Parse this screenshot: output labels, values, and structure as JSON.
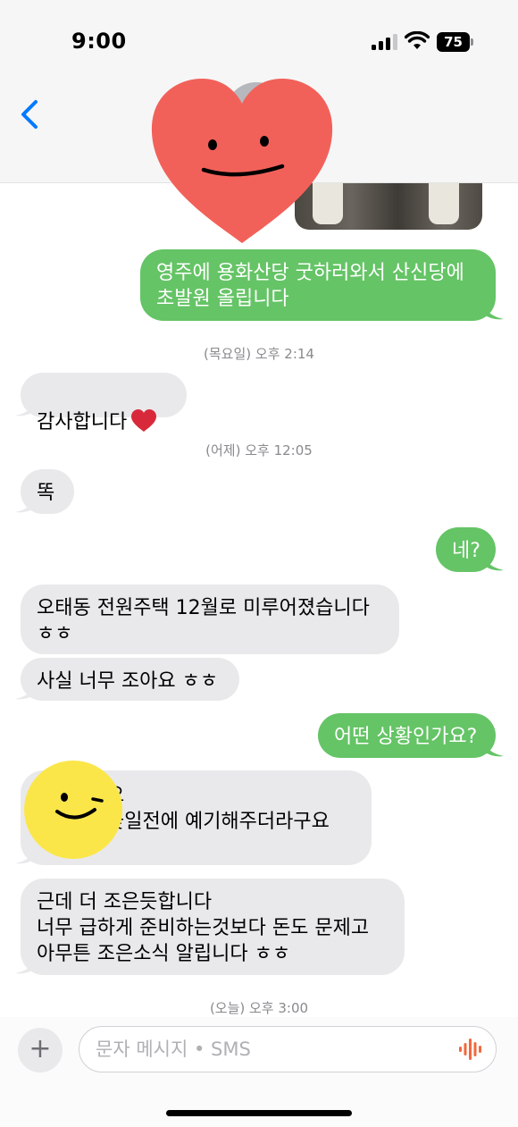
{
  "status_bar": {
    "time": "9:00",
    "battery": "75"
  },
  "header": {
    "back_icon": "chevron-left-icon"
  },
  "messages": [
    {
      "from": "me",
      "text": "영주에 용화산당 굿하러와서 산신당에\n초발원 올립니다"
    },
    {
      "type": "timestamp",
      "text": "(목요일) 오후 2:14"
    },
    {
      "from": "them",
      "text": "감사합니다",
      "emoji": "red-heart-emoji"
    },
    {
      "type": "timestamp",
      "text": "(어제) 오후 12:05"
    },
    {
      "from": "them",
      "text": "똑"
    },
    {
      "from": "me",
      "text": "네?"
    },
    {
      "from": "them",
      "text": "오태동 전원주택 12월로 미루어졌습니다\nㅎㅎ"
    },
    {
      "from": "them",
      "text": "사실 너무 조아요 ㅎㅎ"
    },
    {
      "from": "me",
      "text": "어떤 상황인가요?"
    },
    {
      "from": "them",
      "text": "요\n꽃일전에 예기해주더라구요"
    },
    {
      "from": "them",
      "text": "근데 더 조은듯합니다\n너무 급하게 준비하는것보다 돈도  문제고\n아무튼 조은소식 알립니다 ㅎㅎ"
    },
    {
      "type": "timestamp",
      "text": "(오늘) 오후 3:00"
    }
  ],
  "input": {
    "plus_label": "+",
    "placeholder": "문자 메시지 • SMS"
  },
  "colors": {
    "outgoing_bubble": "#65c466",
    "incoming_bubble": "#e9e9eb",
    "accent": "#007aff",
    "heart_sticker": "#f26159",
    "wink_sticker": "#fbe64a"
  }
}
